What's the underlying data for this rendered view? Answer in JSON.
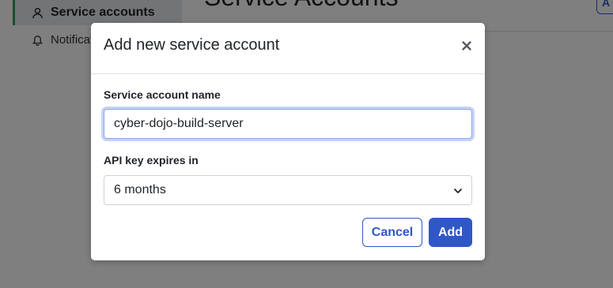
{
  "background": {
    "sidebar": {
      "active_item": "Service accounts",
      "next_item": "Notifications"
    },
    "page_title": "Service Accounts",
    "corner_button_label": "A"
  },
  "modal": {
    "title": "Add new service account",
    "close_icon": "close-icon",
    "fields": {
      "name_label": "Service account name",
      "name_value": "cyber-dojo-build-server",
      "expiry_label": "API key expires in",
      "expiry_value": "6 months"
    },
    "buttons": {
      "cancel": "Cancel",
      "add": "Add"
    }
  },
  "colors": {
    "accent": "#2f57c8",
    "active_indicator": "#3c9a5f"
  }
}
